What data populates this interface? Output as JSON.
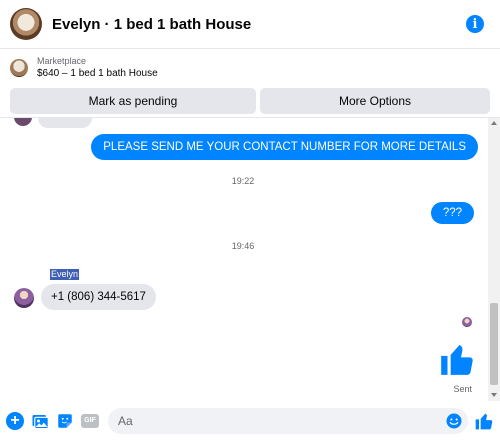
{
  "header": {
    "title": "Evelyn · 1 bed 1 bath House",
    "info_icon_label": "i"
  },
  "marketplace": {
    "label": "Marketplace",
    "listing": "$640 – 1 bed 1 bath House",
    "mark_pending_label": "Mark as pending",
    "more_options_label": "More Options"
  },
  "messages": {
    "outgoing_1": "PLEASE SEND ME YOUR CONTACT NUMBER FOR MORE DETAILS",
    "time_1": "19:22",
    "outgoing_2": "???",
    "time_2": "19:46",
    "sender_name": "Evelyn",
    "incoming_1": "+1 (806) 344-5617",
    "sent_status": "Sent"
  },
  "composer": {
    "placeholder": "Aa",
    "plus_label": "+",
    "gif_label": "GIF"
  },
  "colors": {
    "accent": "#0084ff",
    "bubble_gray": "#e4e6eb"
  },
  "icons": [
    "info-icon",
    "plus-icon",
    "image-icon",
    "sticker-icon",
    "gif-icon",
    "emoji-icon",
    "like-icon"
  ]
}
